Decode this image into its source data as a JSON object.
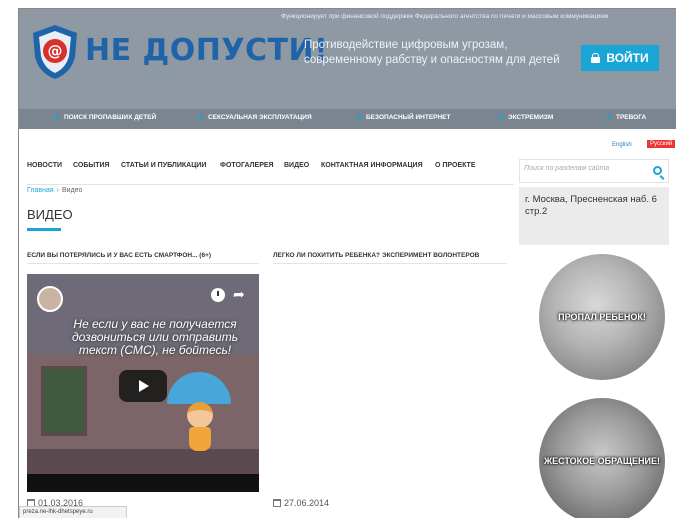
{
  "header": {
    "funding_note": "Функционирует при финансовой поддержке Федерального агентства по печати и массовым коммуникациям",
    "logo_text": "НЕ ДОПУСТИ!",
    "tagline": "Противодействие цифровым угрозам, современному рабству и опасностям для детей",
    "login_label": "ВОЙТИ"
  },
  "category_nav": [
    {
      "label": "ПОИСК ПРОПАВШИХ ДЕТЕЙ"
    },
    {
      "label": "СЕКСУАЛЬНАЯ ЭКСПЛУАТАЦИЯ"
    },
    {
      "label": "БЕЗОПАСНЫЙ ИНТЕРНЕТ"
    },
    {
      "label": "ЭКСТРЕМИЗМ"
    },
    {
      "label": "ТРЕВОГА"
    }
  ],
  "languages": {
    "english": "English",
    "russian": "Русский"
  },
  "main_nav": [
    {
      "label": "НОВОСТИ"
    },
    {
      "label": "СОБЫТИЯ"
    },
    {
      "label": "СТАТЬИ И ПУБЛИКАЦИИ"
    },
    {
      "label": "ФОТОГАЛЕРЕЯ"
    },
    {
      "label": "ВИДЕО"
    },
    {
      "label": "КОНТАКТНАЯ ИНФОРМАЦИЯ"
    },
    {
      "label": "О ПРОЕКТЕ"
    }
  ],
  "breadcrumb": {
    "home": "Главная",
    "separator": "›",
    "current": "Видео"
  },
  "page_title": "ВИДЕО",
  "videos": [
    {
      "title": "ЕСЛИ ВЫ ПОТЕРЯЛИСЬ И У ВАС ЕСТЬ СМАРТФОН... (6+)",
      "overlay_text": "Не если у вас не получается дозвониться или отправить текст (СМС), не бойтесь!",
      "date": "01.03.2016"
    },
    {
      "title": "ЛЕГКО ЛИ ПОХИТИТЬ РЕБЕНКА? ЭКСПЕРИМЕНТ ВОЛОНТЕРОВ",
      "date": "27.06.2014"
    }
  ],
  "sidebar": {
    "search_placeholder": "Поиск по разделам сайта",
    "address": "г. Москва, Пресненская наб. 6 стр.2",
    "banners": [
      {
        "label": "ПРОПАЛ РЕБЕНОК!"
      },
      {
        "label": "ЖЕСТОКОЕ ОБРАЩЕНИЕ!"
      }
    ]
  },
  "status_bar": "preza.ne-lhk-dhetspeye.ru",
  "colors": {
    "accent": "#19a6d6",
    "header_bg": "#8f99a3",
    "nav_bg": "#7b8590",
    "logo": "#1f63a8"
  }
}
